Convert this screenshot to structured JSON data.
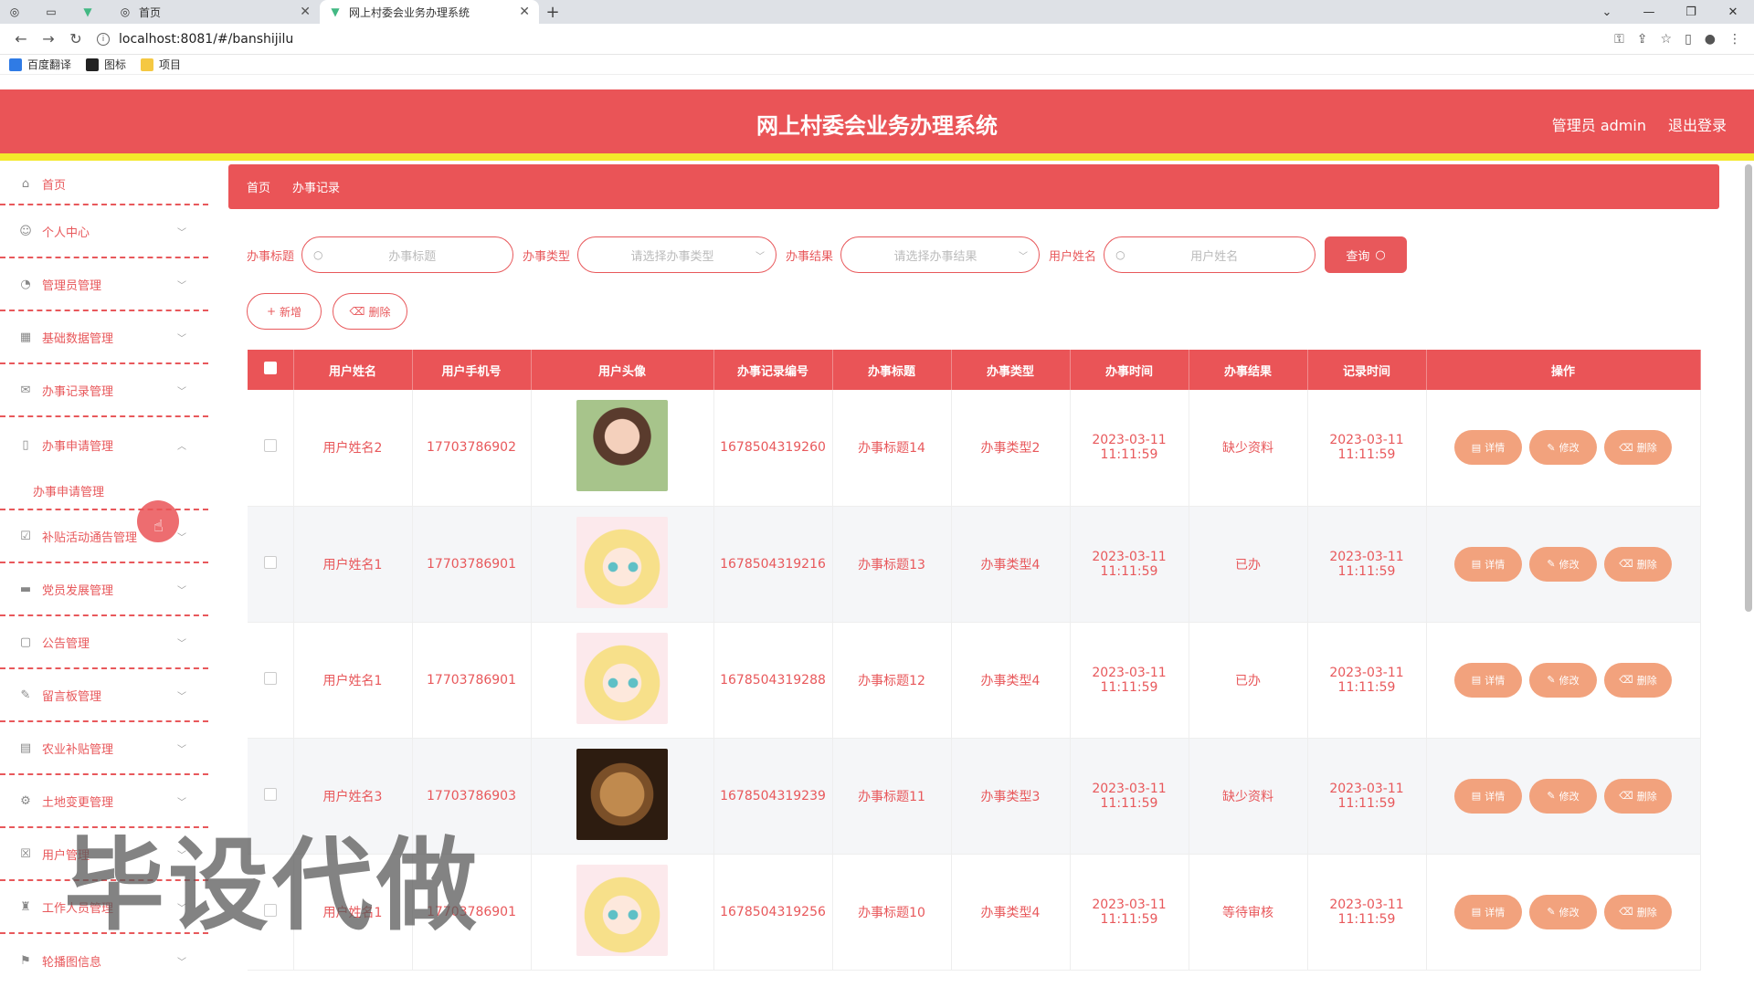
{
  "browser": {
    "tabs": [
      {
        "title": ""
      },
      {
        "title": ""
      },
      {
        "title": ""
      },
      {
        "title": "首页"
      },
      {
        "title": "网上村委会业务办理系统"
      }
    ],
    "url": "localhost:8081/#/banshijilu",
    "bookmarks": [
      "百度翻译",
      "图标",
      "项目"
    ]
  },
  "header": {
    "title": "网上村委会业务办理系统",
    "user": "管理员 admin",
    "logout": "退出登录"
  },
  "sidebar": {
    "items": [
      {
        "label": "首页",
        "icon": "home-icon"
      },
      {
        "label": "个人中心",
        "icon": "user-icon"
      },
      {
        "label": "管理员管理",
        "icon": "admin-icon"
      },
      {
        "label": "基础数据管理",
        "icon": "grid-icon"
      },
      {
        "label": "办事记录管理",
        "icon": "mail-icon"
      },
      {
        "label": "办事申请管理",
        "icon": "phone-icon"
      },
      {
        "label": "补贴活动通告管理",
        "icon": "clipboard-icon"
      },
      {
        "label": "党员发展管理",
        "icon": "monitor-icon"
      },
      {
        "label": "公告管理",
        "icon": "chat-icon"
      },
      {
        "label": "留言板管理",
        "icon": "message-icon"
      },
      {
        "label": "农业补贴管理",
        "icon": "doc-icon"
      },
      {
        "label": "土地变更管理",
        "icon": "settings-icon"
      },
      {
        "label": "用户管理",
        "icon": "users-icon"
      },
      {
        "label": "工作人员管理",
        "icon": "staff-icon"
      },
      {
        "label": "轮播图信息",
        "icon": "flag-icon"
      }
    ],
    "submenu_label": "办事申请管理"
  },
  "breadcrumb": {
    "home": "首页",
    "current": "办事记录"
  },
  "filters": {
    "title_label": "办事标题",
    "title_placeholder": "办事标题",
    "type_label": "办事类型",
    "type_placeholder": "请选择办事类型",
    "result_label": "办事结果",
    "result_placeholder": "请选择办事结果",
    "name_label": "用户姓名",
    "name_placeholder": "用户姓名",
    "query": "查询"
  },
  "actions": {
    "add": "新增",
    "delete": "删除"
  },
  "table": {
    "headers": [
      "用户姓名",
      "用户手机号",
      "用户头像",
      "办事记录编号",
      "办事标题",
      "办事类型",
      "办事时间",
      "办事结果",
      "记录时间",
      "操作"
    ],
    "rows": [
      {
        "name": "用户姓名2",
        "phone": "17703786902",
        "avatar": "girl-photo",
        "code": "1678504319260",
        "title": "办事标题14",
        "type": "办事类型2",
        "time": "2023-03-11 11:11:59",
        "result": "缺少资料",
        "record_time": "2023-03-11 11:11:59"
      },
      {
        "name": "用户姓名1",
        "phone": "17703786901",
        "avatar": "anime-girl",
        "code": "1678504319216",
        "title": "办事标题13",
        "type": "办事类型4",
        "time": "2023-03-11 11:11:59",
        "result": "已办",
        "record_time": "2023-03-11 11:11:59"
      },
      {
        "name": "用户姓名1",
        "phone": "17703786901",
        "avatar": "anime-girl",
        "code": "1678504319288",
        "title": "办事标题12",
        "type": "办事类型4",
        "time": "2023-03-11 11:11:59",
        "result": "已办",
        "record_time": "2023-03-11 11:11:59"
      },
      {
        "name": "用户姓名3",
        "phone": "17703786903",
        "avatar": "puppy",
        "code": "1678504319239",
        "title": "办事标题11",
        "type": "办事类型3",
        "time": "2023-03-11 11:11:59",
        "result": "缺少资料",
        "record_time": "2023-03-11 11:11:59"
      },
      {
        "name": "用户姓名1",
        "phone": "17703786901",
        "avatar": "anime-girl",
        "code": "1678504319256",
        "title": "办事标题10",
        "type": "办事类型4",
        "time": "2023-03-11 11:11:59",
        "result": "等待审核",
        "record_time": "2023-03-11 11:11:59"
      }
    ],
    "op_detail": "详情",
    "op_edit": "修改",
    "op_delete": "删除"
  },
  "watermark": "毕设代做",
  "colors": {
    "primary": "#ea5457",
    "accent": "#f4e92b",
    "op_button": "#f2a27d"
  }
}
